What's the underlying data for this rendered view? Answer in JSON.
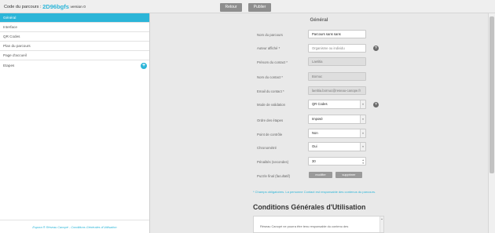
{
  "header": {
    "code_label": "Code du parcours :",
    "code_value": "2D96bgfs",
    "version_label": "version 0",
    "retour_label": "Retour",
    "publier_label": "Publier"
  },
  "sidebar": {
    "items": [
      {
        "label": "Général",
        "active": true
      },
      {
        "label": "Interface"
      },
      {
        "label": "QR Codes"
      },
      {
        "label": "Plan du parcours"
      },
      {
        "label": "Page d'accueil"
      },
      {
        "label": "Etapes"
      }
    ],
    "footer": "Espora ® Réseau Canopé - Conditions Générales d'Utilisation"
  },
  "main": {
    "section_title": "Général",
    "fields": {
      "nom_parcours": {
        "label": "Nom du parcours",
        "value": "Parcours sans sans"
      },
      "auteur": {
        "label": "Auteur affiché *",
        "placeholder": "Organisme ou individu"
      },
      "prenom": {
        "label": "Prénom du contact *",
        "value": "Laetitia"
      },
      "nom_contact": {
        "label": "Nom du contact *",
        "value": "Bornuc"
      },
      "email": {
        "label": "Email du contact *",
        "value": "laetitia.bornuc@reseau-canope.fr"
      },
      "mode_validation": {
        "label": "Mode de validation",
        "value": "QR Codes"
      },
      "ordre": {
        "label": "Ordre des étapes",
        "value": "Imposé"
      },
      "point_controle": {
        "label": "Point de contrôle",
        "value": "Non"
      },
      "chrono": {
        "label": "Chronométré",
        "value": "Oui"
      },
      "penalites": {
        "label": "Pénalités (secondes)",
        "value": "30"
      },
      "puzzle": {
        "label": "Puzzle final (facultatif)",
        "modifier_label": "modifier",
        "supprimer_label": "supprimer"
      }
    },
    "note": "* Champs obligatoires. La personne Contact est responsable des contenus du parcours.",
    "cgu": {
      "title": "Conditions Générales d'Utilisation",
      "text": "Réseau Canopé ne pourra être tenu responsable du contenu des"
    }
  },
  "colors": {
    "accent": "#2bb5d8",
    "button_gray": "#8e8e8e",
    "help_icon": "#6b6b6b"
  },
  "icons": {
    "plus": "plus-icon",
    "help": "help-icon",
    "select_arrow": "chevron-down-icon",
    "spinner": "spinner-icon"
  }
}
